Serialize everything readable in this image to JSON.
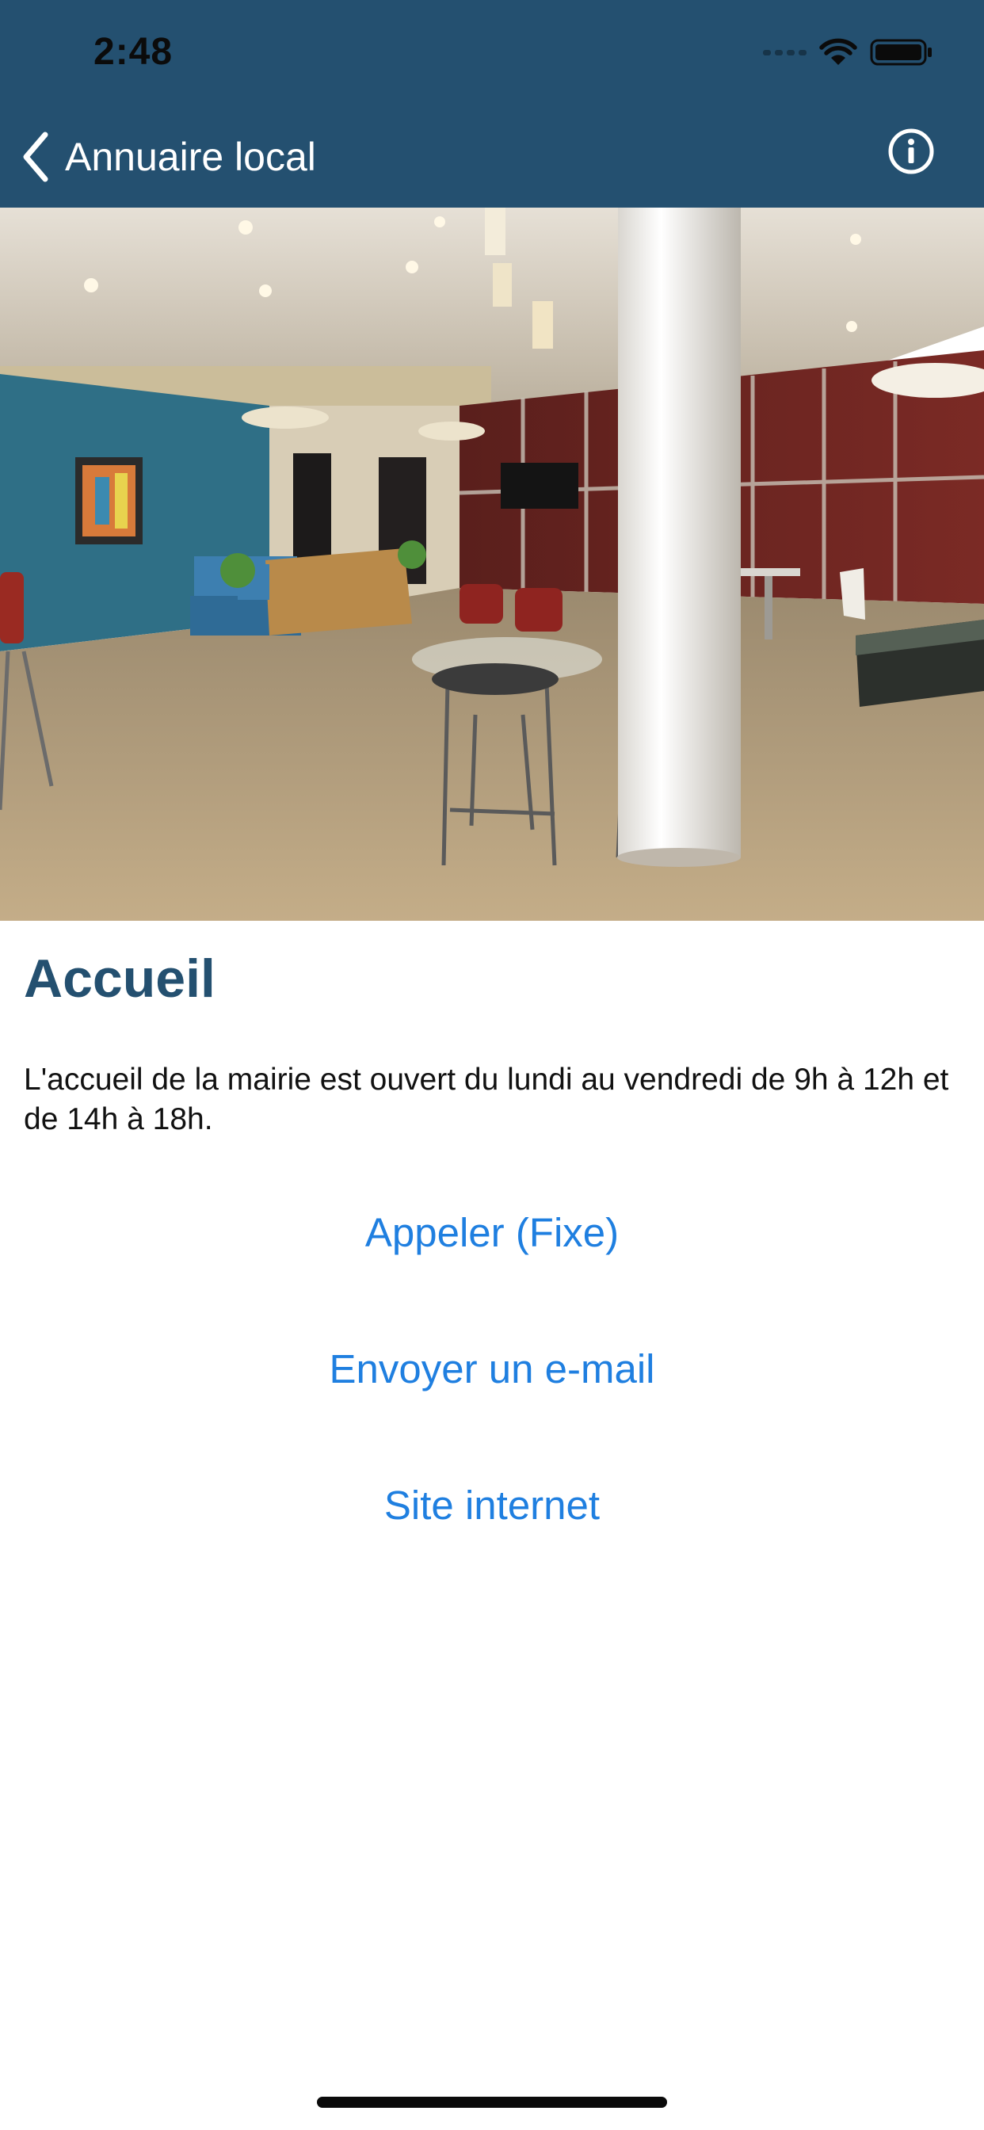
{
  "status_bar": {
    "time": "2:48"
  },
  "nav": {
    "back_label": "Annuaire local",
    "back_icon": "chevron-left-icon",
    "info_icon": "info-icon"
  },
  "hero": {
    "image": "office-lounge-photo"
  },
  "content": {
    "title": "Accueil",
    "description": "L'accueil de la mairie est ouvert du lundi au vendredi de 9h à 12h et de 14h à 18h."
  },
  "actions": {
    "call_label": "Appeler (Fixe)",
    "email_label": "Envoyer un e-mail",
    "website_label": "Site internet"
  },
  "colors": {
    "header_bg": "#245070",
    "title": "#245070",
    "link": "#1f7fe0"
  }
}
